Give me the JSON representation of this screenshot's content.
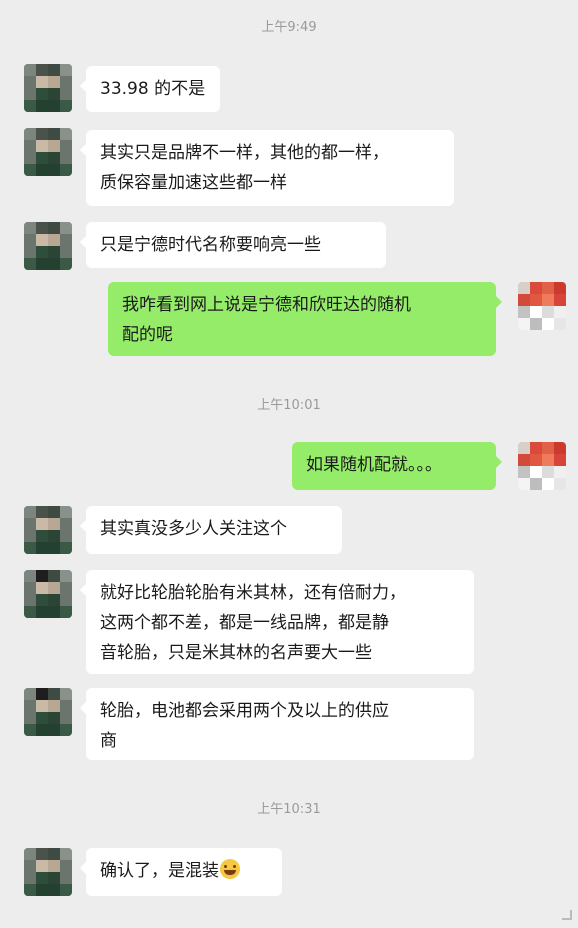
{
  "timestamps": [
    "上午9:49",
    "上午10:01",
    "上午10:31"
  ],
  "messages": [
    {
      "side": "in",
      "text": "33.98 的不是"
    },
    {
      "side": "in",
      "text": "其实只是品牌不一样，其他的都一样，\n质保容量加速这些都一样"
    },
    {
      "side": "in",
      "text": "只是宁德时代名称要响亮一些"
    },
    {
      "side": "out",
      "text": "我咋看到网上说是宁德和欣旺达的随机\n配的呢"
    },
    {
      "side": "out",
      "text": "如果随机配就。。。"
    },
    {
      "side": "in",
      "text": "其实真没多少人关注这个"
    },
    {
      "side": "in",
      "text": "就好比轮胎轮胎有米其林，还有倍耐力，\n这两个都不差，都是一线品牌，都是静\n音轮胎，只是米其林的名声要大一些"
    },
    {
      "side": "in",
      "text": "轮胎，电池都会采用两个及以上的供应\n商"
    },
    {
      "side": "in",
      "text": "确认了，是混装",
      "emoji": "laughing-emoji"
    }
  ],
  "colors": {
    "chat_background": "#ededed",
    "incoming_bubble": "#ffffff",
    "outgoing_bubble": "#95ec69",
    "timestamp_text": "#9a9a9a"
  }
}
